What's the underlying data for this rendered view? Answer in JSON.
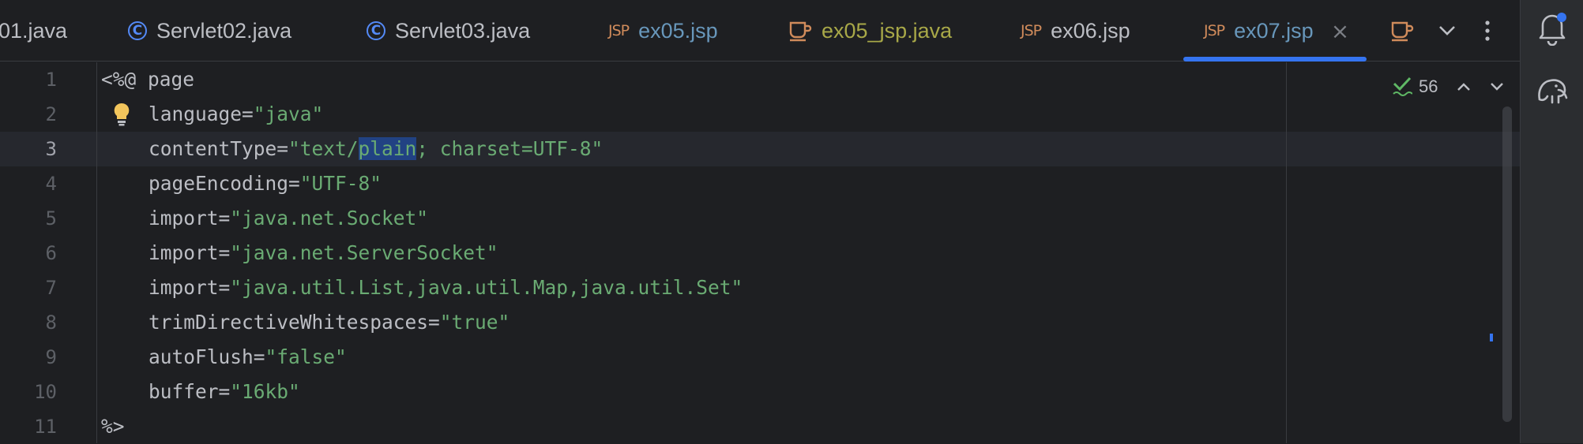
{
  "tabs": [
    {
      "label": "01.java",
      "icon": "class-icon",
      "color": "#bcbec4"
    },
    {
      "label": "Servlet02.java",
      "icon": "class-icon",
      "color": "#bcbec4"
    },
    {
      "label": "Servlet03.java",
      "icon": "class-icon",
      "color": "#bcbec4"
    },
    {
      "label": "ex05.jsp",
      "icon": "jsp-icon",
      "color": "#6897bb"
    },
    {
      "label": "ex05_jsp.java",
      "icon": "java-cup-icon",
      "color": "#a8a848"
    },
    {
      "label": "ex06.jsp",
      "icon": "jsp-icon",
      "color": "#bcbec4"
    },
    {
      "label": "ex07.jsp",
      "icon": "jsp-icon",
      "color": "#6897bb",
      "active": true
    }
  ],
  "tab_icons": {
    "class": "C",
    "jsp": "JSP",
    "close": "×"
  },
  "editor": {
    "current_line": 3,
    "inspection_count": "56",
    "line_numbers": [
      "1",
      "2",
      "3",
      "4",
      "5",
      "6",
      "7",
      "8",
      "9",
      "10",
      "11"
    ],
    "lines": {
      "l1": "<%@ page",
      "l2_attr": "language=",
      "l2_val": "\"java\"",
      "l3_attr": "contentType=",
      "l3_val_a": "\"text/",
      "l3_sel": "plain",
      "l3_val_b": "; charset=UTF-8\"",
      "l4_attr": "pageEncoding=",
      "l4_val": "\"UTF-8\"",
      "l5_attr": "import=",
      "l5_val": "\"java.net.Socket\"",
      "l6_attr": "import=",
      "l6_val": "\"java.net.ServerSocket\"",
      "l7_attr": "import=",
      "l7_val": "\"java.util.List,java.util.Map,java.util.Set\"",
      "l8_attr": "trimDirectiveWhitespaces=",
      "l8_val": "\"true\"",
      "l9_attr": "autoFlush=",
      "l9_val": "\"false\"",
      "l10_attr": "buffer=",
      "l10_val": "\"16kb\"",
      "l11": "%>"
    }
  },
  "colors": {
    "background": "#1e1f22",
    "string": "#6aab73",
    "accent": "#3574f0",
    "selection": "#214283"
  },
  "tools": [
    "notifications-icon",
    "database-elephant-icon"
  ]
}
